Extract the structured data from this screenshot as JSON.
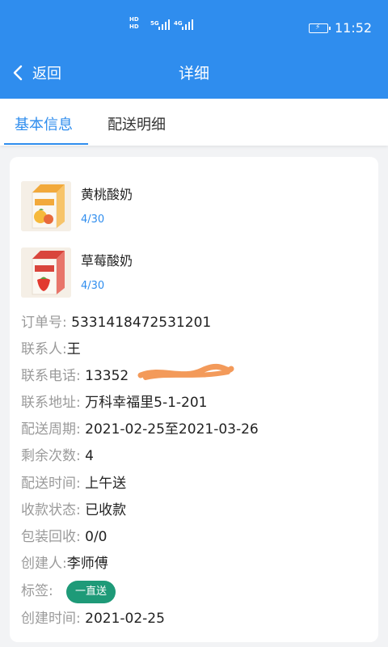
{
  "status_bar": {
    "hd_top": "HD",
    "hd_bottom": "HD",
    "net_5g": "5G",
    "net_4g": "4G",
    "time": "11:52"
  },
  "nav": {
    "back_label": "返回",
    "title": "详细"
  },
  "tabs": [
    {
      "label": "基本信息",
      "active": true
    },
    {
      "label": "配送明细",
      "active": false
    }
  ],
  "products": [
    {
      "name": "黄桃酸奶",
      "count": "4/30",
      "image": "peach-yogurt-carton"
    },
    {
      "name": "草莓酸奶",
      "count": "4/30",
      "image": "strawberry-yogurt-carton"
    }
  ],
  "order_info": {
    "order_no_label": "订单号:",
    "order_no": "5331418472531201",
    "contact_label": "联系人:",
    "contact": "王",
    "phone_label": "联系电话:",
    "phone": "13352",
    "address_label": "联系地址:",
    "address": "万科幸福里5-1-201",
    "period_label": "配送周期:",
    "period": "2021-02-25至2021-03-26",
    "remaining_label": "剩余次数:",
    "remaining": "4",
    "delivery_time_label": "配送时间:",
    "delivery_time": "上午送",
    "payment_status_label": "收款状态:",
    "payment_status": "已收款",
    "packaging_label": "包装回收:",
    "packaging": "0/0",
    "creator_label": "创建人:",
    "creator": "李师傅",
    "tag_label": "标签:",
    "tag": "一直送",
    "created_label": "创建时间:",
    "created": "2021-02-25"
  },
  "colors": {
    "primary": "#2f8dee",
    "tag": "#1e9a78",
    "redaction": "#f39a5a"
  }
}
